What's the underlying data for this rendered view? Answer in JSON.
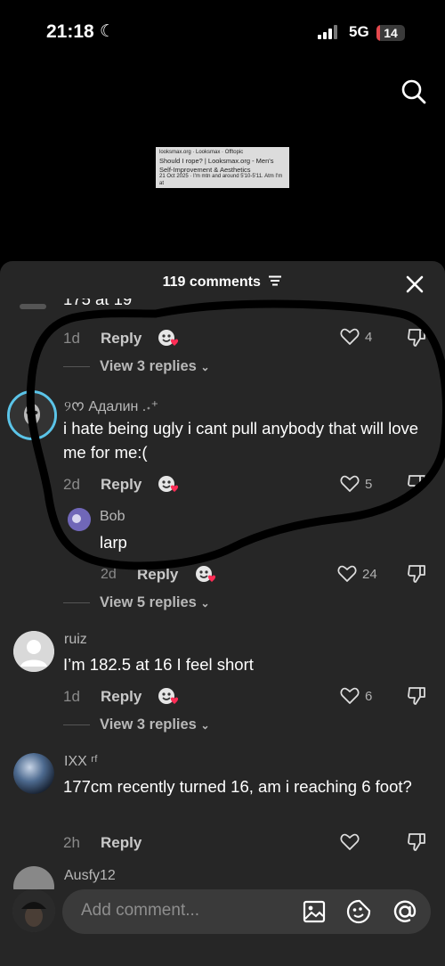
{
  "status": {
    "time": "21:18",
    "network": "5G",
    "battery": "14",
    "battery_level": 0.14
  },
  "video": {
    "line1": "looksmax.org · Looksmax · Offtopic",
    "line2": "Should I rope? | Looksmax.org - Men's Self-Improvement & Aesthetics",
    "line3": "21 Oct 2025 · I'm mtn and around 5'10-5'11. Atm I'm at"
  },
  "sheet": {
    "title": "119 comments"
  },
  "comments": [
    {
      "text": "175 at 19",
      "age": "1d",
      "reply": "Reply",
      "likes": "4",
      "view_replies": "View 3 replies"
    },
    {
      "name": "୨ᰔ Адалин .˖⁺",
      "text": "i hate being ugly i cant pull anybody that will love me for me:(",
      "age": "2d",
      "reply": "Reply",
      "likes": "5"
    },
    {
      "name": "Bob",
      "text": "larp",
      "age": "2d",
      "reply": "Reply",
      "likes": "24",
      "view_replies": "View 5 replies"
    },
    {
      "name": "ruiz",
      "text": "I’m 182.5 at 16 I feel short",
      "age": "1d",
      "reply": "Reply",
      "likes": "6",
      "view_replies": "View 3 replies"
    },
    {
      "name": "IXX ʳᶠ",
      "text": "177cm recently turned 16, am i reaching 6 foot?",
      "age": "2h",
      "reply": "Reply"
    },
    {
      "name": "Ausfy12"
    }
  ],
  "input": {
    "placeholder": "Add comment..."
  },
  "colors": {
    "sheet_bg": "#262626",
    "heart_red": "#fe2c55",
    "battery_red": "#e5484d"
  }
}
